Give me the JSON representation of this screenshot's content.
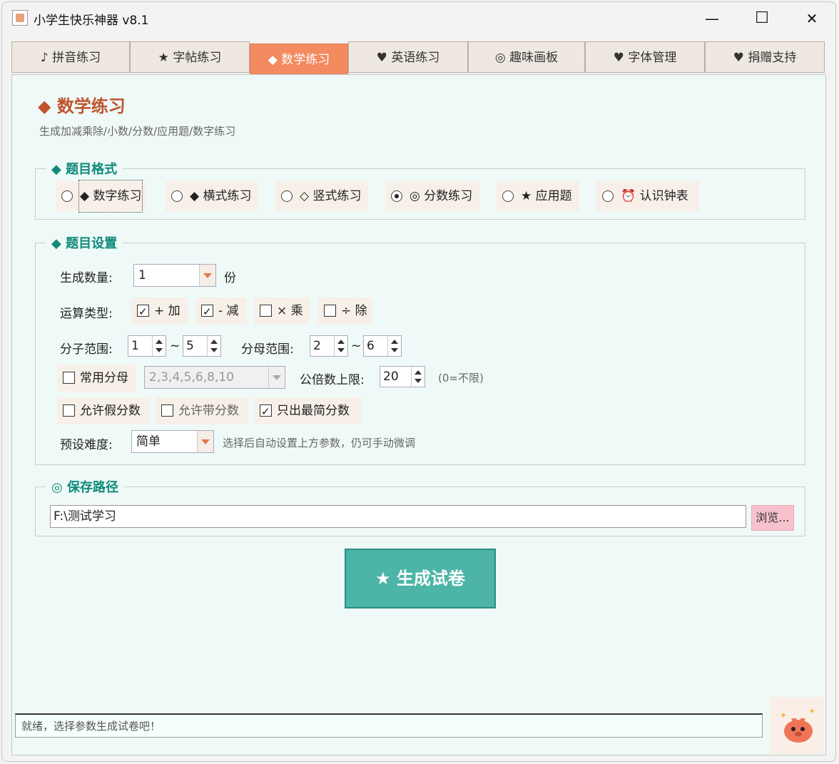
{
  "window": {
    "title": "小学生快乐神器 v8.1",
    "controls": {
      "minimize": "—",
      "maximize": "☐",
      "close": "✕"
    }
  },
  "tabs": [
    {
      "label": "♪ 拼音练习",
      "active": false
    },
    {
      "label": "★ 字帖练习",
      "active": false
    },
    {
      "label": "◆ 数学练习",
      "active": true
    },
    {
      "label": "♥ 英语练习",
      "active": false
    },
    {
      "label": "◎ 趣味画板",
      "active": false
    },
    {
      "label": "♥ 字体管理",
      "active": false
    },
    {
      "label": "♥ 捐赠支持",
      "active": false
    }
  ],
  "main": {
    "title": "◆ 数学练习",
    "subtitle": "生成加减乘除/小数/分数/应用题/数字练习"
  },
  "format_group": {
    "title": "◆ 题目格式",
    "options": [
      {
        "label": "◆ 数字练习",
        "checked": false
      },
      {
        "label": "◆ 横式练习",
        "checked": false
      },
      {
        "label": "◇ 竖式练习",
        "checked": false
      },
      {
        "label": "◎ 分数练习",
        "checked": true
      },
      {
        "label": "★ 应用题",
        "checked": false
      },
      {
        "label": "⏰ 认识钟表",
        "checked": false
      }
    ]
  },
  "settings_group": {
    "title": "◆ 题目设置",
    "count_label": "生成数量:",
    "count_value": "1",
    "count_unit": "份",
    "ops_label": "运算类型:",
    "ops": [
      {
        "label": "+ 加",
        "checked": true
      },
      {
        "label": "- 减",
        "checked": true
      },
      {
        "label": "× 乘",
        "checked": false
      },
      {
        "label": "÷ 除",
        "checked": false
      }
    ],
    "numerator_label": "分子范围:",
    "numerator_min": "1",
    "numerator_max": "5",
    "tilde": "~",
    "denominator_label": "分母范围:",
    "denominator_min": "2",
    "denominator_max": "6",
    "common_denominator_label": "常用分母",
    "common_denominator_checked": false,
    "common_denominator_value": "2,3,4,5,6,8,10",
    "lcm_label": "公倍数上限:",
    "lcm_value": "20",
    "lcm_hint": "(0=不限)",
    "improper_label": "允许假分数",
    "improper_checked": false,
    "mixed_label": "允许带分数",
    "mixed_checked": false,
    "simplest_label": "只出最简分数",
    "simplest_checked": true,
    "difficulty_label": "预设难度:",
    "difficulty_value": "简单",
    "difficulty_hint": "选择后自动设置上方参数，仍可手动微调"
  },
  "path_group": {
    "title": "◎ 保存路径",
    "path_value": "F:\\测试学习",
    "browse_label": "浏览..."
  },
  "generate_label": "★ 生成试卷",
  "status_text": "就绪，选择参数生成试卷吧！",
  "colors": {
    "accent": "#f38a60",
    "teal": "#4db5a8",
    "panel_bg": "#effaf8",
    "group_title": "#0f8a7a"
  }
}
